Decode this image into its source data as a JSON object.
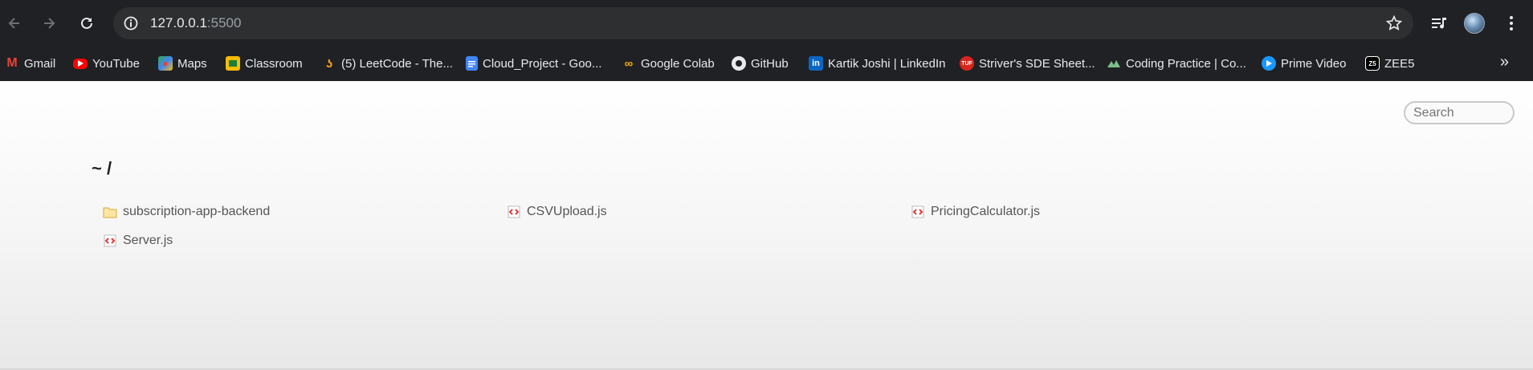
{
  "browser": {
    "url_host": "127.0.0.1",
    "url_port": ":5500"
  },
  "bookmarks": [
    {
      "label": "Gmail",
      "icon": "gmail-icon"
    },
    {
      "label": "YouTube",
      "icon": "youtube-icon"
    },
    {
      "label": "Maps",
      "icon": "maps-icon"
    },
    {
      "label": "Classroom",
      "icon": "classroom-icon"
    },
    {
      "label": "(5) LeetCode - The...",
      "icon": "leetcode-icon"
    },
    {
      "label": "Cloud_Project - Goo...",
      "icon": "google-docs-icon"
    },
    {
      "label": "Google Colab",
      "icon": "colab-icon"
    },
    {
      "label": "GitHub",
      "icon": "github-icon"
    },
    {
      "label": "Kartik Joshi | LinkedIn",
      "icon": "linkedin-icon"
    },
    {
      "label": "Striver's SDE Sheet...",
      "icon": "tuf-icon"
    },
    {
      "label": "Coding Practice | Co...",
      "icon": "gfg-icon"
    },
    {
      "label": "Prime Video",
      "icon": "prime-video-icon"
    },
    {
      "label": "ZEE5",
      "icon": "zee5-icon"
    }
  ],
  "page": {
    "search_placeholder": "Search",
    "breadcrumb": "~ /",
    "files": [
      {
        "name": "subscription-app-backend",
        "type": "folder"
      },
      {
        "name": "CSVUpload.js",
        "type": "js"
      },
      {
        "name": "PricingCalculator.js",
        "type": "js"
      },
      {
        "name": "Server.js",
        "type": "js"
      }
    ]
  }
}
